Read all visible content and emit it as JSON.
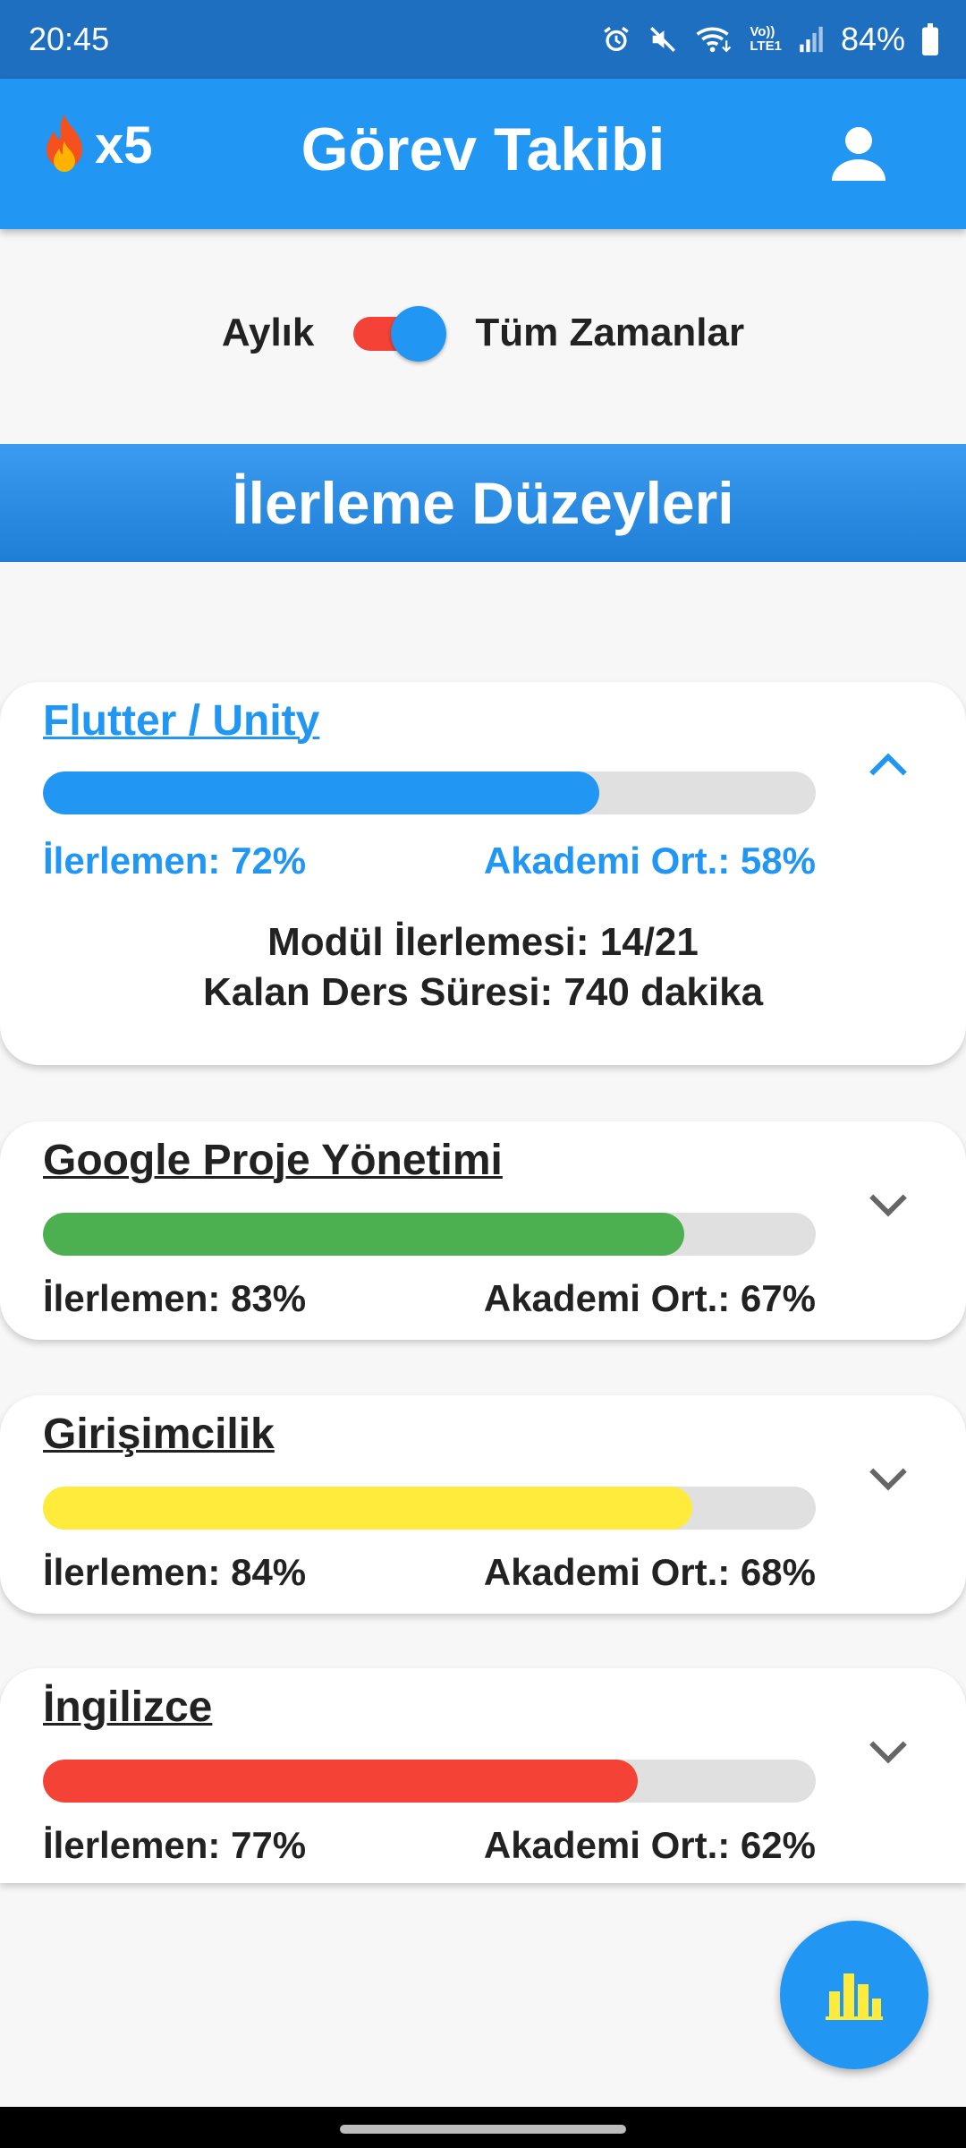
{
  "status_bar": {
    "time": "20:45",
    "battery": "84%",
    "network_label_top": "Vo))",
    "network_label_bottom": "LTE1",
    "icons": [
      "alarm-icon",
      "mute-icon",
      "wifi-icon",
      "signal-icon",
      "battery-icon"
    ]
  },
  "app_bar": {
    "streak_icon": "fire-icon",
    "streak_count": "x5",
    "title": "Görev Takibi",
    "profile_icon": "person-icon"
  },
  "toggle": {
    "left_label": "Aylık",
    "right_label": "Tüm Zamanlar",
    "state": "Tüm Zamanlar"
  },
  "section_title": "İlerleme Düzeyleri",
  "courses": [
    {
      "title": "Flutter / Unity",
      "progress": 72,
      "progress_label": "İlerlemen: 72%",
      "avg_label": "Akademi Ort.: 58%",
      "color": "#2196f3",
      "expanded": true,
      "module_label": "Modül İlerlemesi: 14/21",
      "remaining_label": "Kalan Ders Süresi: 740 dakika"
    },
    {
      "title": "Google Proje Yönetimi",
      "progress": 83,
      "progress_label": "İlerlemen: 83%",
      "avg_label": "Akademi Ort.: 67%",
      "color": "#4caf50",
      "expanded": false
    },
    {
      "title": "Girişimcilik",
      "progress": 84,
      "progress_label": "İlerlemen: 84%",
      "avg_label": "Akademi Ort.: 68%",
      "color": "#ffeb3b",
      "expanded": false
    },
    {
      "title": "İngilizce",
      "progress": 77,
      "progress_label": "İlerlemen: 77%",
      "avg_label": "Akademi Ort.: 62%",
      "color": "#f44336",
      "expanded": false
    }
  ],
  "fab": {
    "icon": "bar-chart-icon",
    "icon_color": "#ffeb3b"
  },
  "colors": {
    "primary": "#2196f3",
    "status_bar": "#1e6fc0",
    "track": "#e0e0e0"
  }
}
